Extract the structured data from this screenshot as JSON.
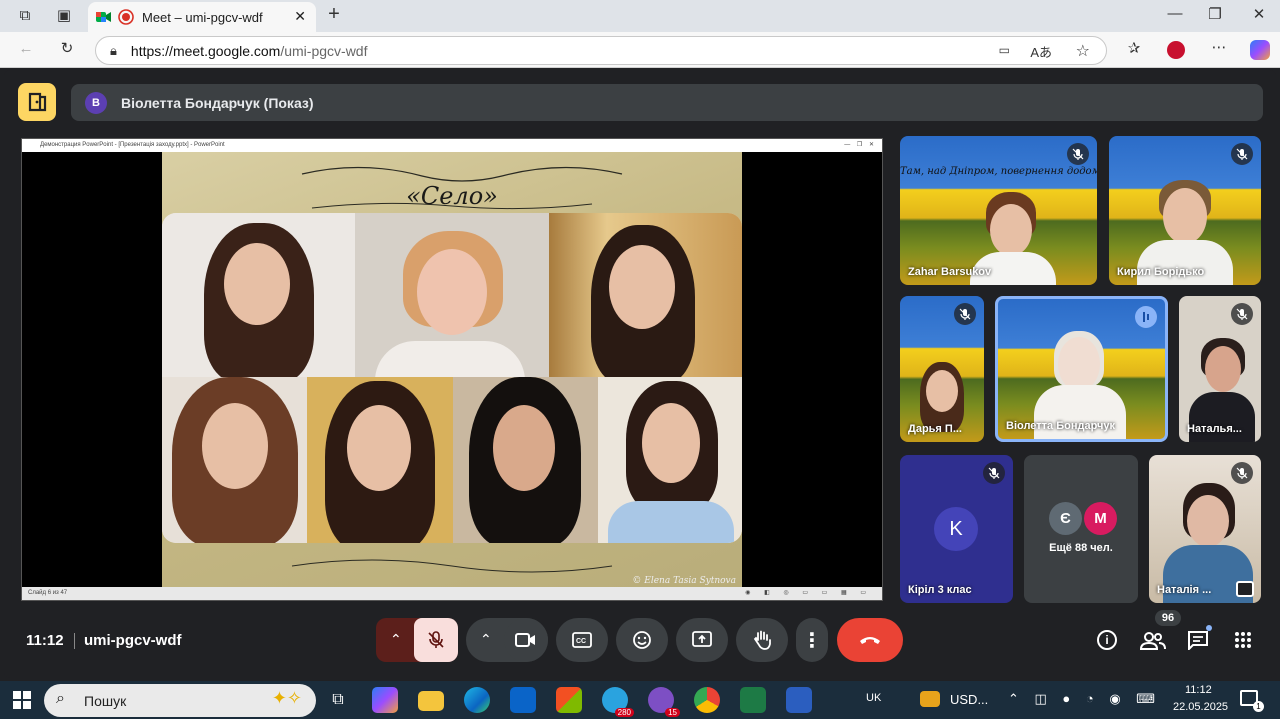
{
  "browser": {
    "tab_title": "Meet – umi-pgcv-wdf",
    "url_host": "https://meet.google.com",
    "url_path": "/umi-pgcv-wdf"
  },
  "presenter": {
    "initial": "В",
    "label": "Віолетта Бондарчук (Показ)"
  },
  "slide": {
    "title": "«Село»",
    "ppt_window_title": "Демонстрация PowerPoint - [Презентація заходу.pptx] - PowerPoint",
    "status": "Слайд 6 из 47",
    "signature": "© Elena Tasia Sytnova"
  },
  "participants": [
    {
      "name": "Zahar Barsukov",
      "muted": true
    },
    {
      "name": "Кирил Борідько",
      "muted": true
    },
    {
      "name": "Дарья П...",
      "muted": true
    },
    {
      "name": "Віолетта Бондарчук",
      "muted": false
    },
    {
      "name": "Наталья...",
      "muted": true
    },
    {
      "name": "Кірiл 3 клас",
      "initial": "K",
      "muted": true
    },
    {
      "name": "Наталія ...",
      "muted": true
    }
  ],
  "others": {
    "label": "Ещё 88 чел.",
    "initials": [
      "Є",
      "М"
    ]
  },
  "banner_text": "Там, над Дніпром, повернення додому",
  "meeting": {
    "time": "11:12",
    "code": "umi-pgcv-wdf",
    "participant_count": "96"
  },
  "taskbar": {
    "search_placeholder": "Пошук",
    "telegram_badge": "280",
    "viber_badge": "15",
    "lang": "UK",
    "ticker": "USD...",
    "time": "11:12",
    "date": "22.05.2025",
    "notif": "1"
  },
  "colors": {
    "end_call": "#ea4335",
    "muted_mic": "#f9dedc",
    "presenter_badge": "#fdd663",
    "speaking_border": "#8ab4f8"
  }
}
